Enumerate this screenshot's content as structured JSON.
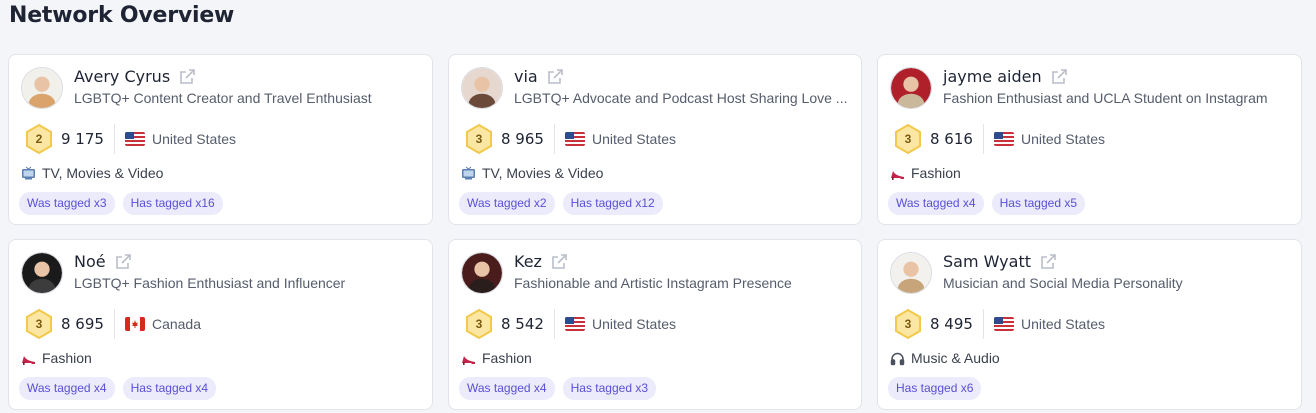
{
  "page": {
    "title": "Network Overview"
  },
  "cards": [
    {
      "name": "Avery Cyrus",
      "bio": "LGBTQ+ Content Creator and Travel Enthusiast",
      "level": "2",
      "followers": "9 175",
      "flag": "us-flag-icon",
      "country": "United States",
      "category_icon": "tv-icon",
      "category": "TV, Movies & Video",
      "tags": [
        "Was tagged x3",
        "Has tagged x16"
      ]
    },
    {
      "name": "via",
      "bio": "LGBTQ+ Advocate and Podcast Host Sharing Love ...",
      "level": "3",
      "followers": "8 965",
      "flag": "us-flag-icon",
      "country": "United States",
      "category_icon": "tv-icon",
      "category": "TV, Movies & Video",
      "tags": [
        "Was tagged x2",
        "Has tagged x12"
      ]
    },
    {
      "name": "jayme aiden",
      "bio": "Fashion Enthusiast and UCLA Student on Instagram",
      "level": "3",
      "followers": "8 616",
      "flag": "us-flag-icon",
      "country": "United States",
      "category_icon": "high-heel-icon",
      "category": "Fashion",
      "tags": [
        "Was tagged x4",
        "Has tagged x5"
      ]
    },
    {
      "name": "Noé",
      "bio": "LGBTQ+ Fashion Enthusiast and Influencer",
      "level": "3",
      "followers": "8 695",
      "flag": "ca-flag-icon",
      "country": "Canada",
      "category_icon": "high-heel-icon",
      "category": "Fashion",
      "tags": [
        "Was tagged x4",
        "Has tagged x4"
      ]
    },
    {
      "name": "Kez",
      "bio": "Fashionable and Artistic Instagram Presence",
      "level": "3",
      "followers": "8 542",
      "flag": "us-flag-icon",
      "country": "United States",
      "category_icon": "high-heel-icon",
      "category": "Fashion",
      "tags": [
        "Was tagged x4",
        "Has tagged x3"
      ]
    },
    {
      "name": "Sam Wyatt",
      "bio": "Musician and Social Media Personality",
      "level": "3",
      "followers": "8 495",
      "flag": "us-flag-icon",
      "country": "United States",
      "category_icon": "headphones-icon",
      "category": "Music & Audio",
      "tags": [
        "Has tagged x6"
      ]
    }
  ],
  "colors": {
    "tag_bg": "#ecebfb",
    "tag_text": "#5a4fd6",
    "badge_gold": "#f5c542"
  }
}
